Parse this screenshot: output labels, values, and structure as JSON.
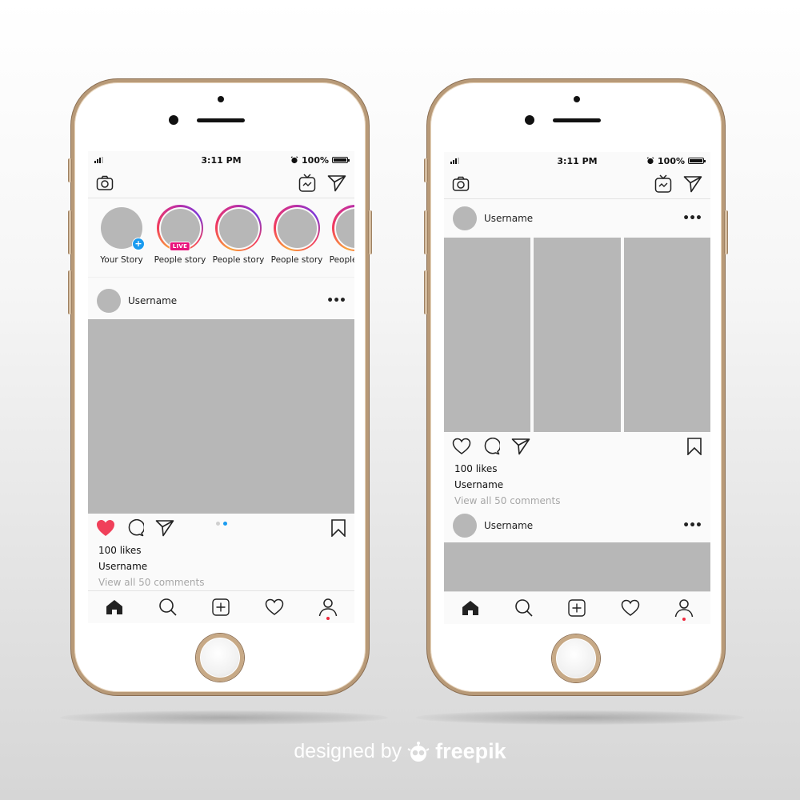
{
  "colors": {
    "gold_frame": "#b89a78",
    "screen_bg": "#fafafa",
    "placeholder_gray": "#b7b7b7",
    "like_red": "#f0405a",
    "accent_blue": "#1a9bf0",
    "live_pink": "#e8147c",
    "muted_text": "#a7a7a7"
  },
  "phones": [
    {
      "statusbar": {
        "time": "3:11 PM",
        "battery": "100%",
        "icons": [
          "signal-icon",
          "alarm-icon",
          "battery-icon"
        ]
      },
      "topbar": {
        "icons": [
          "camera-icon",
          "igtv-icon",
          "direct-message-icon"
        ]
      },
      "stories": [
        {
          "label": "Your Story",
          "type": "own",
          "badge": "+"
        },
        {
          "label": "People story",
          "type": "live",
          "badge": "LIVE"
        },
        {
          "label": "People story",
          "type": "ring"
        },
        {
          "label": "People story",
          "type": "ring"
        },
        {
          "label": "People story",
          "type": "ring"
        }
      ],
      "post": {
        "username": "Username",
        "more": "•••",
        "liked": true,
        "carousel_pages": 2,
        "carousel_active": 2,
        "likes": "100 likes",
        "caption_user": "Username",
        "comments_link": "View all 50 comments"
      },
      "bottomnav": [
        "home-icon",
        "search-icon",
        "new-post-icon",
        "activity-heart-icon",
        "profile-icon"
      ]
    },
    {
      "statusbar": {
        "time": "3:11 PM",
        "battery": "100%",
        "icons": [
          "signal-icon",
          "alarm-icon",
          "battery-icon"
        ]
      },
      "topbar": {
        "icons": [
          "camera-icon",
          "igtv-icon",
          "direct-message-icon"
        ]
      },
      "post": {
        "username": "Username",
        "more": "•••",
        "liked": false,
        "grid_images": 3,
        "likes": "100 likes",
        "caption_user": "Username",
        "comments_link": "View all 50 comments"
      },
      "next_post": {
        "username": "Username",
        "more": "•••"
      },
      "bottomnav": [
        "home-icon",
        "search-icon",
        "new-post-icon",
        "activity-heart-icon",
        "profile-icon"
      ]
    }
  ],
  "credit": {
    "prefix": "designed by",
    "brand": "freepik"
  }
}
